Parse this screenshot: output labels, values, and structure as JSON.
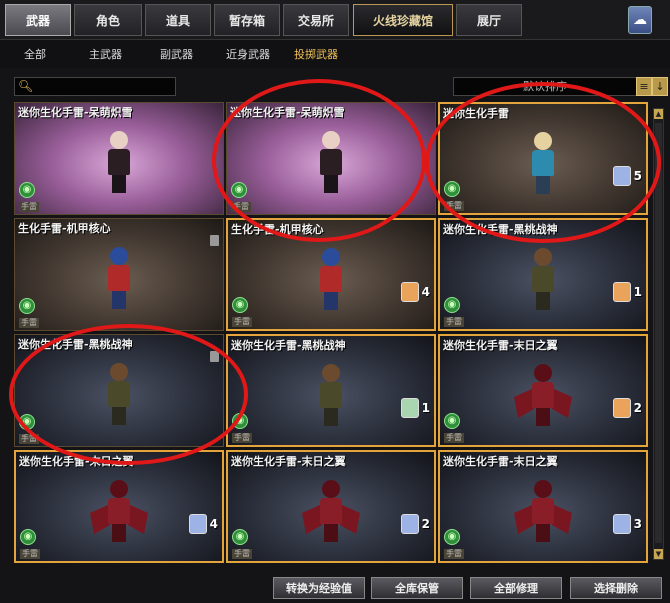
{
  "main_tabs": [
    {
      "label": "武器"
    },
    {
      "label": "角色"
    },
    {
      "label": "道具"
    },
    {
      "label": "暂存箱"
    },
    {
      "label": "交易所"
    },
    {
      "label": "火线珍藏馆"
    },
    {
      "label": "展厅"
    }
  ],
  "sub_tabs": [
    {
      "label": "全部"
    },
    {
      "label": "主武器"
    },
    {
      "label": "副武器"
    },
    {
      "label": "近身武器"
    },
    {
      "label": "投掷武器"
    }
  ],
  "search": {
    "placeholder": ""
  },
  "sort": {
    "label": "默认排序"
  },
  "items": [
    {
      "name": "迷你生化手雷-呆萌炽雪",
      "count": "",
      "tag": "手雷",
      "theme": "pink"
    },
    {
      "name": "迷你生化手雷-呆萌炽雪",
      "count": "",
      "tag": "手雷",
      "theme": "pink"
    },
    {
      "name": "迷你生化手雷",
      "count": "5",
      "tag": "手雷",
      "theme": "brown"
    },
    {
      "name": "生化手雷-机甲核心",
      "count": "",
      "tag": "手雷",
      "theme": "brown"
    },
    {
      "name": "生化手雷-机甲核心",
      "count": "4",
      "tag": "手雷",
      "theme": "brown"
    },
    {
      "name": "迷你生化手雷-黑桃战神",
      "count": "1",
      "tag": "手雷",
      "theme": "blue"
    },
    {
      "name": "迷你生化手雷-黑桃战神",
      "count": "",
      "tag": "手雷",
      "theme": "blue"
    },
    {
      "name": "迷你生化手雷-黑桃战神",
      "count": "1",
      "tag": "手雷",
      "theme": "blue"
    },
    {
      "name": "迷你生化手雷-末日之翼",
      "count": "2",
      "tag": "手雷",
      "theme": "blue"
    },
    {
      "name": "迷你生化手雷-末日之翼",
      "count": "4",
      "tag": "手雷",
      "theme": "blue"
    },
    {
      "name": "迷你生化手雷-末日之翼",
      "count": "2",
      "tag": "手雷",
      "theme": "blue"
    },
    {
      "name": "迷你生化手雷-末日之翼",
      "count": "3",
      "tag": "手雷",
      "theme": "blue"
    }
  ],
  "actions": {
    "convert": "转换为经验值",
    "store_all": "全库保管",
    "repair_all": "全部修理",
    "select_delete": "选择删除"
  },
  "icons": [
    "search-icon",
    "cloud-icon",
    "sort-list-icon",
    "sort-down-icon",
    "grenade-badge-icon",
    "trash-icon"
  ]
}
